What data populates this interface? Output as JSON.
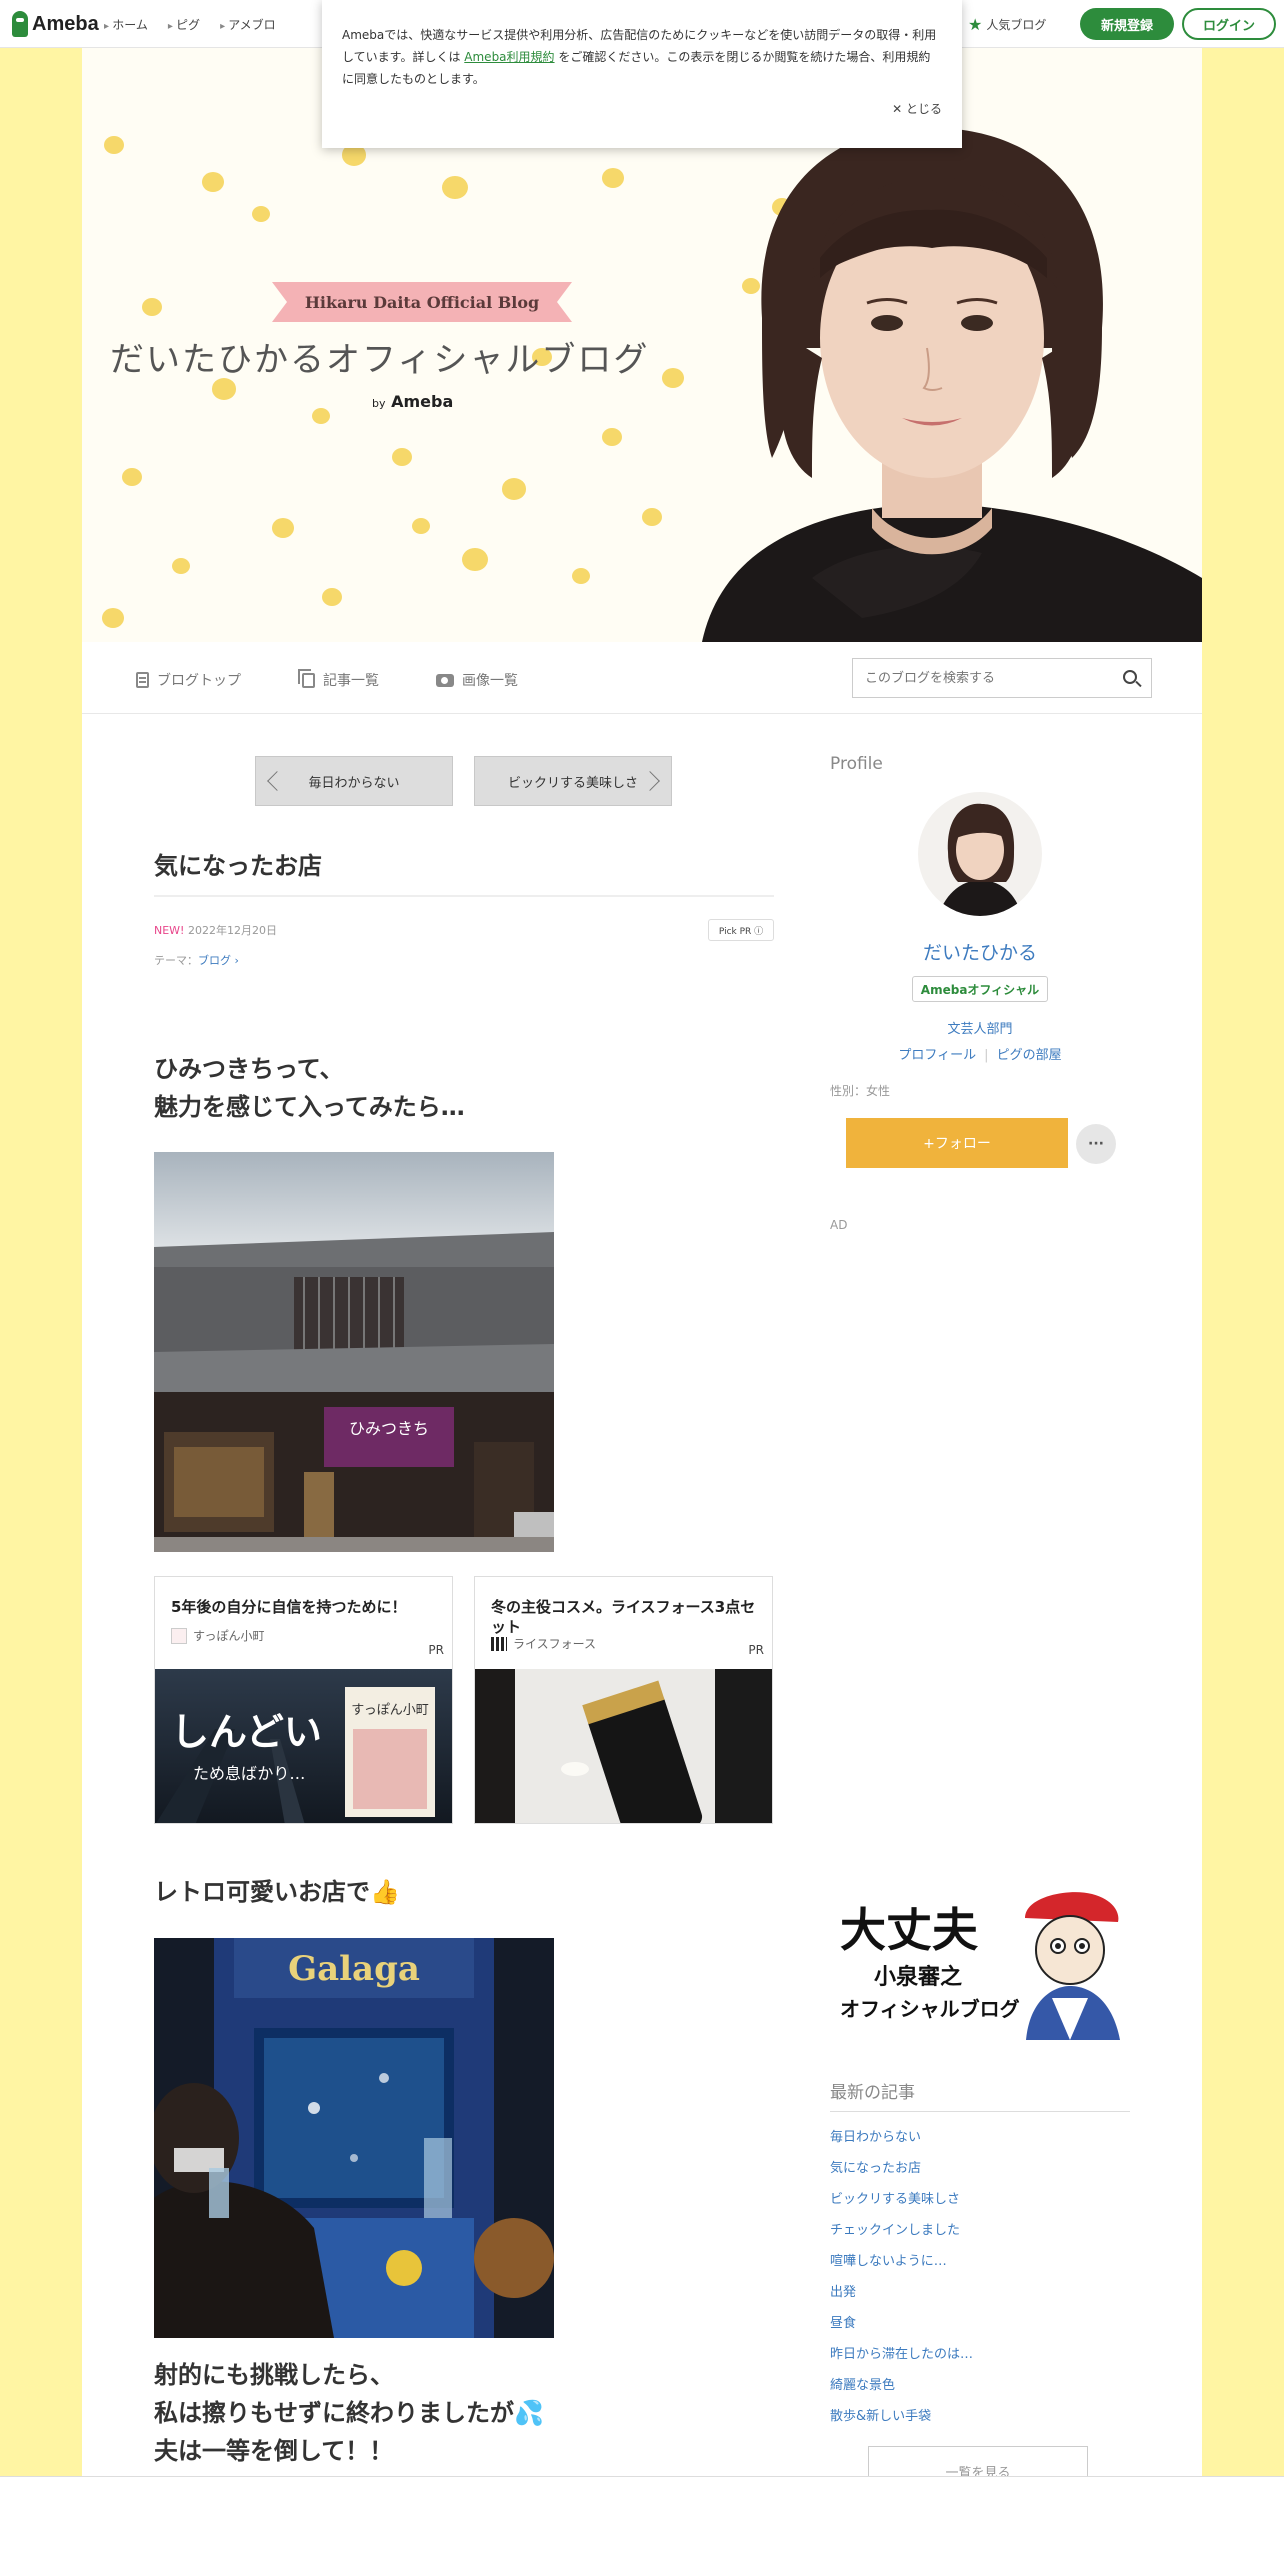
{
  "global_header": {
    "logo": "Ameba",
    "nav": [
      "ホーム",
      "ピグ",
      "アメブロ"
    ],
    "popular_blog": "人気ブログ",
    "signup": "新規登録",
    "login": "ログイン"
  },
  "cookie_notice": {
    "text_before": "Amebaでは、快適なサービス提供や利用分析、広告配信のためにクッキーなどを使い訪問データの取得・利用しています。詳しくは",
    "link": "Ameba利用規約",
    "text_after": "をご確認ください。この表示を閉じるか閲覧を続けた場合、利用規約に同意したものとします。",
    "close": "✕ とじる"
  },
  "hero": {
    "ribbon": "Hikaru Daita Official Blog",
    "title": "だいたひかるオフィシャルブログ",
    "by": "by",
    "by_brand": "Ameba"
  },
  "blog_nav": {
    "top": "ブログトップ",
    "entries": "記事一覧",
    "images": "画像一覧",
    "search_placeholder": "このブログを検索する"
  },
  "pager": {
    "prev": "毎日わからない",
    "next": "ビックリする美味しさ"
  },
  "article": {
    "title": "気になったお店",
    "new_label": "NEW!",
    "date": "2022年12月20日",
    "pick_pr": "Pick PR ⓘ",
    "theme_label": "テーマ：",
    "theme": "ブログ",
    "para1_line1": "ひみつきちって、",
    "para1_line2": "魅力を感じて入ってみたら…",
    "shop_sign": "ひみつきち",
    "para2": "レトロ可愛いお店で👍",
    "game_title": "Galaga",
    "para3_line1": "射的にも挑戦したら、",
    "para3_line2": "私は擦りもせずに終わりましたが💦",
    "para3_line3": "夫は一等を倒して！！"
  },
  "ads": [
    {
      "title": "5年後の自分に自信を持つために！",
      "source": "すっぽん小町",
      "pr": "PR",
      "img_big": "しんどい",
      "img_small": "ため息ばかり…",
      "product": "すっぽん小町"
    },
    {
      "title": "冬の主役コスメ。ライスフォース3点セット",
      "source": "ライスフォース",
      "pr": "PR"
    }
  ],
  "sidebar": {
    "profile_heading": "Profile",
    "name": "だいたひかる",
    "badge": "Amebaオフィシャル",
    "category": "文芸人部門",
    "profile_link": "プロフィール",
    "pigg_link": "ピグの部屋",
    "gender": "性別：女性",
    "follow": "+フォロー",
    "more": "···",
    "ad_label": "AD",
    "banner_line1": "大丈夫",
    "banner_line2": "小泉審之",
    "banner_line3": "オフィシャルブログ",
    "recent_heading": "最新の記事",
    "recent": [
      "毎日わからない",
      "気になったお店",
      "ビックリする美味しさ",
      "チェックインしました",
      "喧嘩しないように…",
      "出発",
      "昼食",
      "昨日から滞在したのは…",
      "綺麗な景色",
      "散歩&新しい手袋"
    ],
    "view_all": "一覧を見る"
  },
  "colors": {
    "accent_green": "#2d8c3c",
    "background_yellow": "#fff5a3",
    "link_blue": "#3d7bbf",
    "follow_orange": "#f0b33c"
  }
}
